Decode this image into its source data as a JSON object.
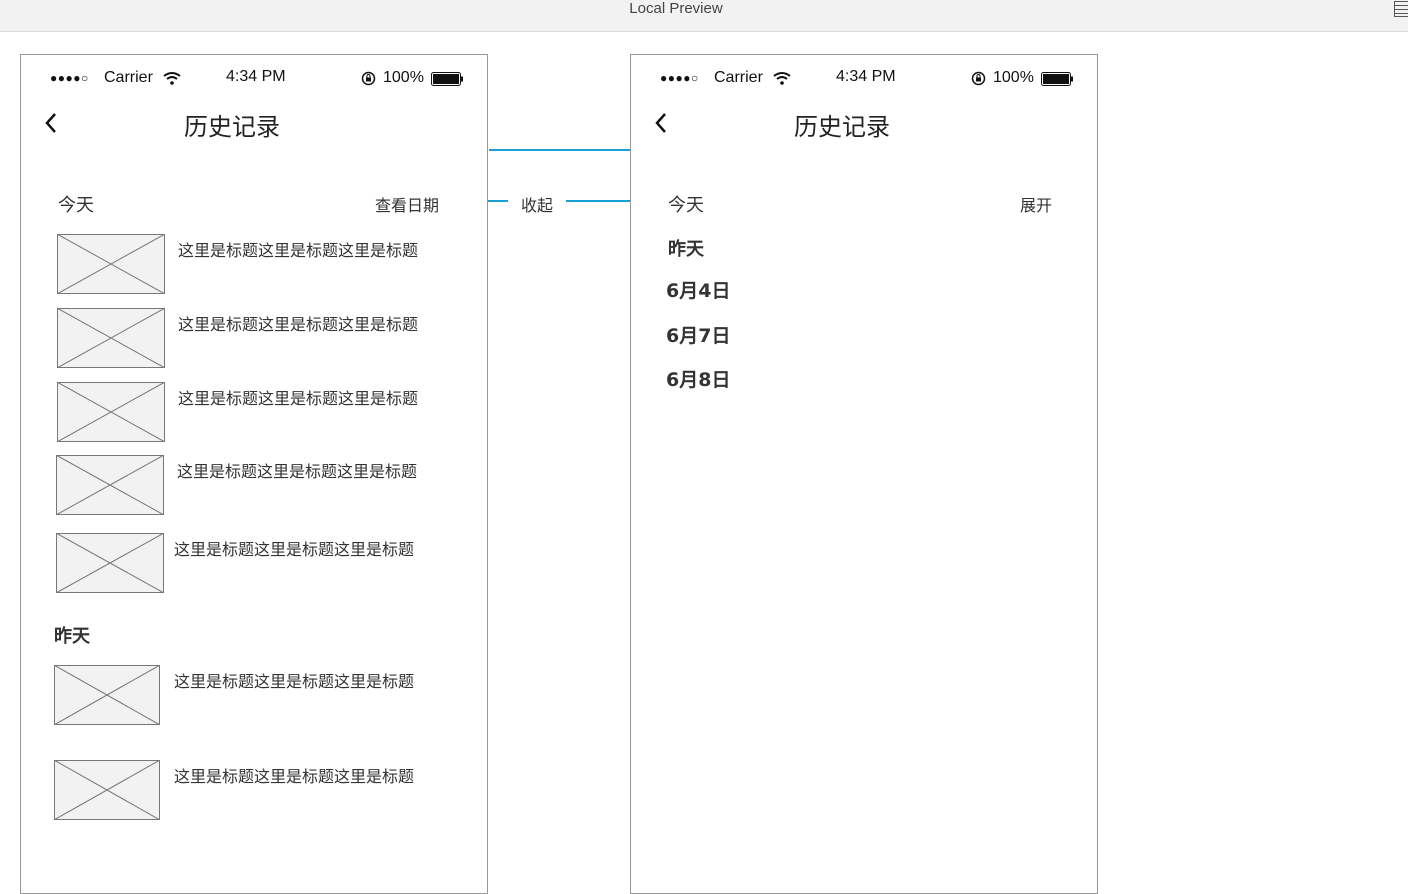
{
  "window": {
    "title": "Local Preview"
  },
  "status_bar": {
    "carrier": "Carrier",
    "time": "4:34 PM",
    "battery": "100%"
  },
  "left_screen": {
    "nav_title": "历史记录",
    "today_label": "今天",
    "view_date_label": "查看日期",
    "yesterday_label": "昨天",
    "today_items": [
      "这里是标题这里是标题这里是标题",
      "这里是标题这里是标题这里是标题",
      "这里是标题这里是标题这里是标题",
      "这里是标题这里是标题这里是标题",
      "这里是标题这里是标题这里是标题"
    ],
    "yesterday_items": [
      "这里是标题这里是标题这里是标题",
      "这里是标题这里是标题这里是标题"
    ]
  },
  "right_screen": {
    "nav_title": "历史记录",
    "today_label": "今天",
    "expand_label": "展开",
    "yesterday_label": "昨天",
    "dates": [
      "6月4日",
      "6月7日",
      "6月8日"
    ]
  },
  "connector": {
    "collapse_label": "收起",
    "color": "#1a9fd6"
  }
}
